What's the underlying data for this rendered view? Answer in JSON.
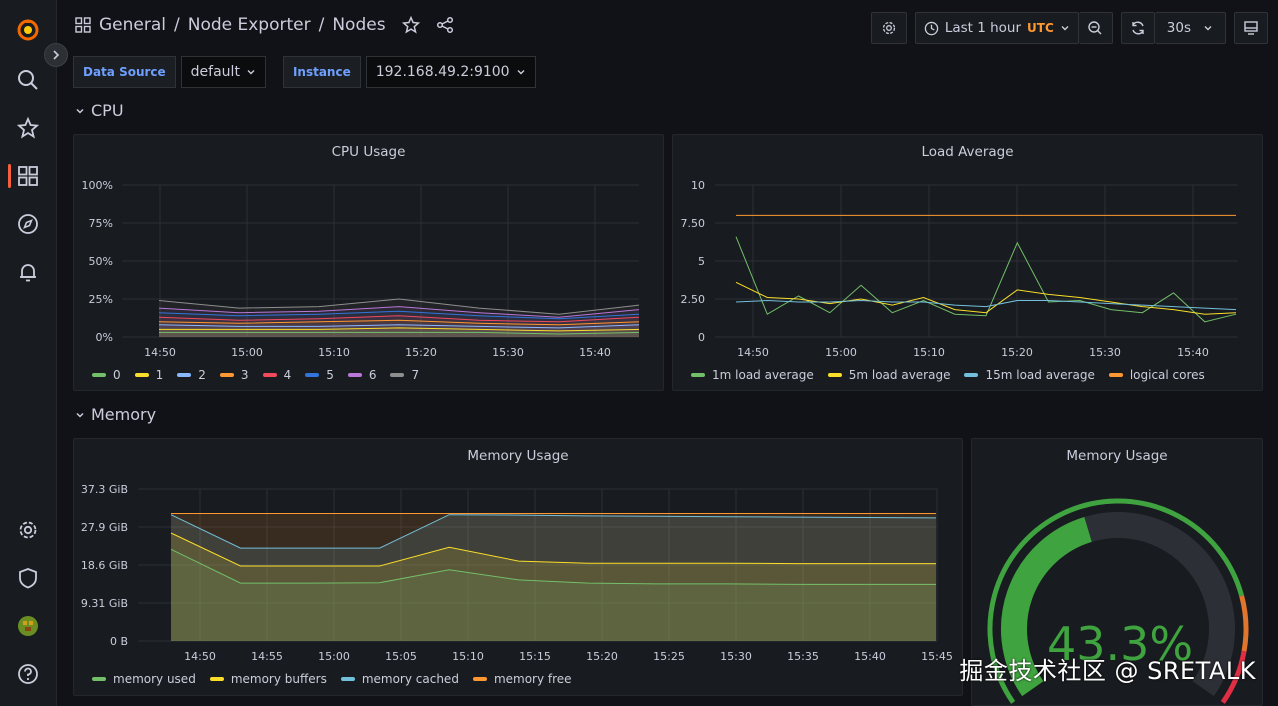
{
  "breadcrumb": {
    "folder": "General",
    "sep": "/",
    "parent": "Node Exporter",
    "page": "Nodes"
  },
  "toolbar": {
    "time_range": "Last 1 hour",
    "timezone": "UTC",
    "refresh": "30s"
  },
  "variables": [
    {
      "label": "Data Source",
      "value": "default"
    },
    {
      "label": "Instance",
      "value": "192.168.49.2:9100"
    }
  ],
  "rows": {
    "cpu": "CPU",
    "memory": "Memory"
  },
  "panels": {
    "cpu_usage": {
      "title": "CPU Usage"
    },
    "load_average": {
      "title": "Load Average"
    },
    "memory_usage": {
      "title": "Memory Usage"
    },
    "memory_gauge": {
      "title": "Memory Usage",
      "value": "43.3%"
    }
  },
  "watermark": "掘金技术社区 @ SRETALK",
  "colors": {
    "accent": "#f55f3e",
    "green": "#73bf69",
    "yellow": "#fade2a",
    "cyan": "#5794f2",
    "orange": "#ff9830",
    "red": "#f2495c",
    "blue": "#3274d9",
    "purple": "#b877d9",
    "grey": "#8e8e8e"
  },
  "chart_data": [
    {
      "type": "line",
      "title": "CPU Usage",
      "x": [
        "14:50",
        "15:00",
        "15:10",
        "15:20",
        "15:30",
        "15:40"
      ],
      "y_ticks": [
        "100%",
        "75%",
        "50%",
        "25%",
        "0%"
      ],
      "ylim": [
        0,
        100
      ],
      "series": [
        {
          "name": "0",
          "color": "#73bf69",
          "values": [
            3,
            3,
            3,
            3,
            3,
            2,
            3
          ]
        },
        {
          "name": "1",
          "color": "#fade2a",
          "values": [
            5,
            5,
            5,
            6,
            5,
            4,
            5
          ]
        },
        {
          "name": "2",
          "color": "#8ab8ff",
          "values": [
            8,
            7,
            7,
            8,
            7,
            6,
            8
          ]
        },
        {
          "name": "3",
          "color": "#ff9830",
          "values": [
            10,
            9,
            10,
            11,
            9,
            8,
            10
          ]
        },
        {
          "name": "4",
          "color": "#f2495c",
          "values": [
            13,
            11,
            12,
            14,
            11,
            10,
            13
          ]
        },
        {
          "name": "5",
          "color": "#3274d9",
          "values": [
            16,
            14,
            15,
            17,
            14,
            12,
            15
          ]
        },
        {
          "name": "6",
          "color": "#b877d9",
          "values": [
            19,
            16,
            17,
            20,
            16,
            13,
            18
          ]
        },
        {
          "name": "7",
          "color": "#8e8e8e",
          "values": [
            24,
            19,
            20,
            25,
            19,
            15,
            21
          ]
        }
      ]
    },
    {
      "type": "line",
      "title": "Load Average",
      "x": [
        "14:50",
        "15:00",
        "15:10",
        "15:20",
        "15:30",
        "15:40"
      ],
      "y_ticks": [
        "10",
        "7.50",
        "5",
        "2.50",
        "0"
      ],
      "ylim": [
        0,
        10
      ],
      "series": [
        {
          "name": "1m load average",
          "color": "#73bf69",
          "values": [
            6.6,
            1.5,
            2.7,
            1.6,
            3.4,
            1.6,
            2.4,
            1.5,
            1.4,
            6.2,
            2.3,
            2.4,
            1.8,
            1.6,
            2.9,
            1.0,
            1.5
          ]
        },
        {
          "name": "5m load average",
          "color": "#fade2a",
          "values": [
            3.6,
            2.6,
            2.5,
            2.2,
            2.5,
            2.1,
            2.6,
            1.8,
            1.6,
            3.1,
            2.8,
            2.6,
            2.3,
            2.0,
            1.8,
            1.5,
            1.6
          ]
        },
        {
          "name": "15m load average",
          "color": "#73c0dc",
          "values": [
            2.3,
            2.4,
            2.3,
            2.3,
            2.4,
            2.3,
            2.3,
            2.1,
            2.0,
            2.4,
            2.4,
            2.3,
            2.2,
            2.1,
            2.0,
            1.9,
            1.8
          ]
        },
        {
          "name": "logical cores",
          "color": "#ff9830",
          "values": [
            8,
            8,
            8,
            8,
            8,
            8,
            8,
            8,
            8,
            8,
            8,
            8,
            8,
            8,
            8,
            8,
            8
          ]
        }
      ]
    },
    {
      "type": "area",
      "title": "Memory Usage",
      "x": [
        "14:50",
        "14:55",
        "15:00",
        "15:05",
        "15:10",
        "15:15",
        "15:20",
        "15:25",
        "15:30",
        "15:35",
        "15:40",
        "15:45"
      ],
      "y_ticks": [
        "37.3 GiB",
        "27.9 GiB",
        "18.6 GiB",
        "9.31 GiB",
        "0 B"
      ],
      "ylim": [
        0,
        37.3
      ],
      "series": [
        {
          "name": "memory used",
          "color": "#73bf69",
          "values": [
            22.5,
            14.2,
            14.2,
            14.3,
            17.5,
            15.0,
            14.2,
            14.0,
            14.0,
            13.9,
            13.9,
            13.9
          ]
        },
        {
          "name": "memory buffers",
          "color": "#fade2a",
          "values": [
            26.5,
            18.4,
            18.4,
            18.4,
            23.0,
            19.6,
            19.1,
            19.1,
            19.1,
            19.0,
            19.0,
            19.0
          ]
        },
        {
          "name": "memory cached",
          "color": "#73c0dc",
          "values": [
            31.0,
            22.8,
            22.8,
            22.8,
            31.0,
            30.9,
            30.7,
            30.6,
            30.5,
            30.4,
            30.3,
            30.2
          ]
        },
        {
          "name": "memory free",
          "color": "#ff9830",
          "values": [
            31.3,
            31.3,
            31.3,
            31.3,
            31.3,
            31.3,
            31.3,
            31.3,
            31.3,
            31.3,
            31.3,
            31.3
          ]
        }
      ]
    },
    {
      "type": "gauge",
      "title": "Memory Usage",
      "value": 43.3,
      "unit": "%"
    }
  ]
}
